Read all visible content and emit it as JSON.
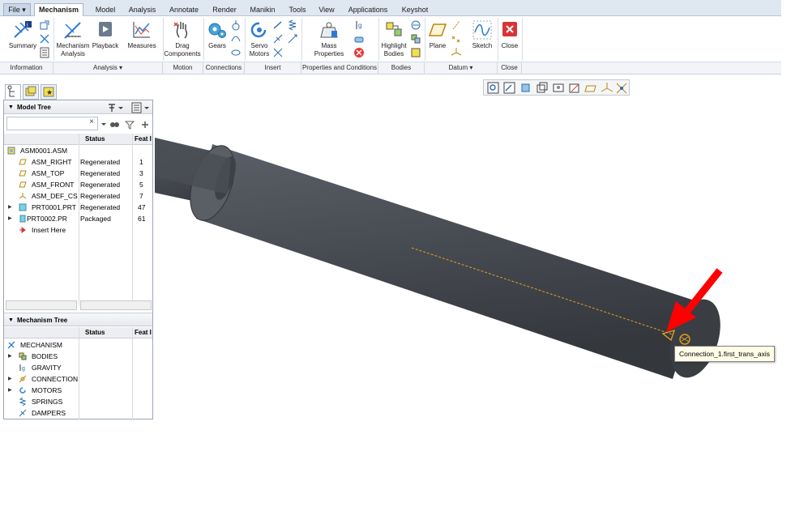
{
  "tabs": [
    {
      "label": "File ▾"
    },
    {
      "label": "Mechanism"
    },
    {
      "label": "Model"
    },
    {
      "label": "Analysis"
    },
    {
      "label": "Annotate"
    },
    {
      "label": "Render"
    },
    {
      "label": "Manikin"
    },
    {
      "label": "Tools"
    },
    {
      "label": "View"
    },
    {
      "label": "Applications"
    },
    {
      "label": "Keyshot"
    }
  ],
  "ribbon": {
    "summary": "Summary",
    "mech_analysis_1": "Mechanism",
    "mech_analysis_2": "Analysis",
    "playback": "Playback",
    "measures": "Measures",
    "drag_1": "Drag",
    "drag_2": "Components",
    "gears": "Gears",
    "servo_1": "Servo",
    "servo_2": "Motors",
    "mass_1": "Mass",
    "mass_2": "Properties",
    "highlight_1": "Highlight",
    "highlight_2": "Bodies",
    "plane": "Plane",
    "sketch": "Sketch",
    "close": "Close"
  },
  "groups": [
    {
      "label": "Information"
    },
    {
      "label": "Analysis ▾"
    },
    {
      "label": "Motion"
    },
    {
      "label": "Connections"
    },
    {
      "label": "Insert"
    },
    {
      "label": "Properties and Conditions"
    },
    {
      "label": "Bodies"
    },
    {
      "label": "Datum ▾"
    },
    {
      "label": "Close"
    }
  ],
  "model_tree": {
    "title": "Model Tree",
    "search_value": "",
    "clear_glyph": "×",
    "columns": {
      "status": "Status",
      "feat": "Feat I"
    },
    "rows": [
      {
        "name": "ASM0001.ASM",
        "status": "",
        "feat": ""
      },
      {
        "name": "ASM_RIGHT",
        "status": "Regenerated",
        "feat": "1"
      },
      {
        "name": "ASM_TOP",
        "status": "Regenerated",
        "feat": "3"
      },
      {
        "name": "ASM_FRONT",
        "status": "Regenerated",
        "feat": "5"
      },
      {
        "name": "ASM_DEF_CS",
        "status": "Regenerated",
        "feat": "7"
      },
      {
        "name": "PRT0001.PRT",
        "status": "Regenerated",
        "feat": "47"
      },
      {
        "name": "PRT0002.PR",
        "status": "Packaged",
        "feat": "61"
      },
      {
        "name": "Insert Here",
        "status": "",
        "feat": ""
      }
    ]
  },
  "mechanism_tree": {
    "title": "Mechanism Tree",
    "columns": {
      "status": "Status",
      "feat": "Feat I"
    },
    "rows": [
      {
        "name": "MECHANISM"
      },
      {
        "name": "BODIES"
      },
      {
        "name": "GRAVITY"
      },
      {
        "name": "CONNECTION"
      },
      {
        "name": "MOTORS"
      },
      {
        "name": "SPRINGS"
      },
      {
        "name": "DAMPERS"
      }
    ]
  },
  "viewport": {
    "tooltip": "Connection_1.first_trans_axis"
  },
  "colors": {
    "shaft_dark": "#3c4045",
    "shaft_light": "#5a5f66",
    "axis_line": "#e0a020",
    "arrow": "#ff0000",
    "tab_bar": "#dfe7f1"
  }
}
